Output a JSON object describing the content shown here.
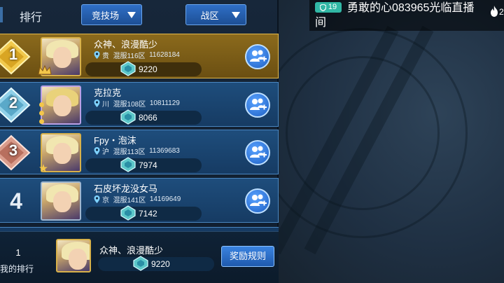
{
  "header": {
    "title": "排行",
    "mode_dropdown": "竞技场",
    "zone_dropdown": "战区"
  },
  "rankings": [
    {
      "rank": "1",
      "name": "众神、浪漫酷少",
      "province": "贵",
      "server": "混服116区",
      "id": "11628184",
      "score": "9220"
    },
    {
      "rank": "2",
      "name": "克拉克",
      "province": "川",
      "server": "混服108区",
      "id": "10811129",
      "score": "8066"
    },
    {
      "rank": "3",
      "name": "Fpy・泡沫",
      "province": "沪",
      "server": "混服113区",
      "id": "11369683",
      "score": "7974"
    },
    {
      "rank": "4",
      "name": "石皮坏龙没女马",
      "province": "京",
      "server": "混服141区",
      "id": "14169649",
      "score": "7142"
    }
  ],
  "my_rank": {
    "position": "1",
    "label": "我的排行",
    "name": "众神、浪漫酷少",
    "score": "9220",
    "reward_button": "奖励规则"
  },
  "stream_overlay": {
    "level": "19",
    "message": "勇敢的心083965光临直播间",
    "viewers": "2"
  },
  "colors": {
    "gold_row": "#8b6a1c",
    "blue_row": "#1e4d7c",
    "accent_button": "#2f74d6",
    "level_badge": "#31b7a5"
  },
  "icons": [
    "location-pin-icon",
    "score-gem-icon",
    "add-team-icon",
    "crown-icon",
    "fire-icon",
    "shield-icon"
  ]
}
